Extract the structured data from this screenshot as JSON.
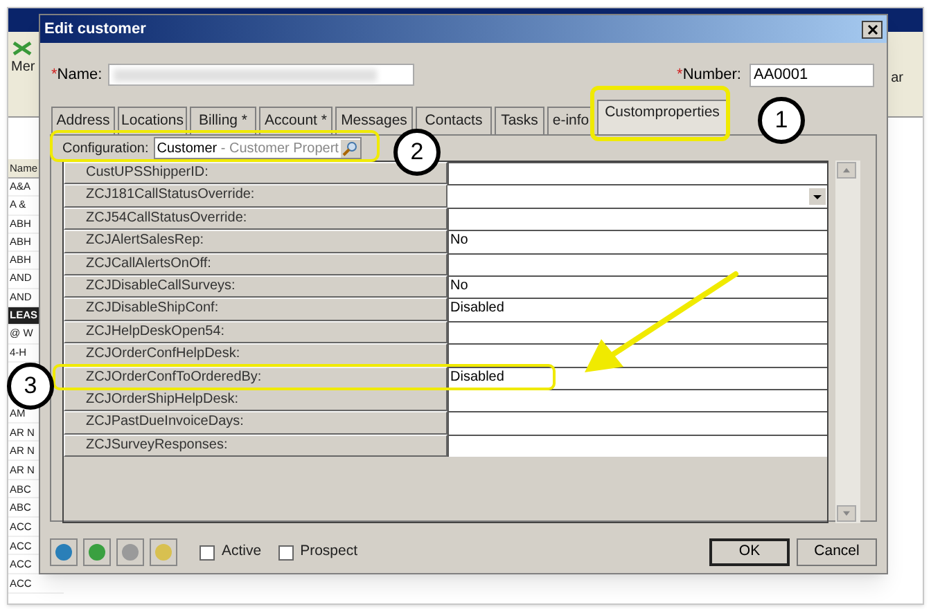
{
  "background_app": {
    "toolbar_label": "Mer",
    "toolbar_fragment": "ar",
    "list_header": "Name",
    "list_rows_upper": [
      {
        "text": "A&A",
        "selected": false
      },
      {
        "text": "A &",
        "selected": false
      },
      {
        "text": "ABH",
        "selected": false
      },
      {
        "text": "ABH",
        "selected": false
      },
      {
        "text": "ABH",
        "selected": false
      },
      {
        "text": "AND",
        "selected": false
      },
      {
        "text": "AND",
        "selected": false
      },
      {
        "text": "LEAS",
        "selected": true
      },
      {
        "text": "@ W",
        "selected": false
      },
      {
        "text": "4-H",
        "selected": false
      }
    ],
    "list_rows_lower": [
      {
        "text": "AM",
        "selected": false
      },
      {
        "text": "AR N",
        "selected": false
      },
      {
        "text": "AR N",
        "selected": false
      },
      {
        "text": "AR N",
        "selected": false
      },
      {
        "text": "ABC",
        "selected": false
      },
      {
        "text": "ABC",
        "selected": false
      },
      {
        "text": "ACC",
        "selected": false
      },
      {
        "text": "ACC",
        "selected": false
      },
      {
        "text": "ACC",
        "selected": false
      },
      {
        "text": "ACC",
        "selected": false
      }
    ]
  },
  "dialog": {
    "title": "Edit customer",
    "name": {
      "label": "Name:",
      "required_mark": "*"
    },
    "number": {
      "label": "Number:",
      "required_mark": "*",
      "value": "AA0001"
    },
    "tabs": [
      {
        "label": "Address",
        "selected": false
      },
      {
        "label": "Locations",
        "selected": false
      },
      {
        "label": "Billing *",
        "selected": false
      },
      {
        "label": "Account *",
        "selected": false
      },
      {
        "label": "Messages",
        "selected": false
      },
      {
        "label": "Contacts",
        "selected": false
      },
      {
        "label": "Tasks",
        "selected": false
      },
      {
        "label": "e-info",
        "selected": false
      },
      {
        "label": "Customproperties",
        "selected": true
      }
    ],
    "configuration": {
      "label": "Configuration:",
      "value": "Customer",
      "detail": "- Customer Propert"
    },
    "properties": [
      {
        "label": "CustUPSShipperID:",
        "kind": "text"
      },
      {
        "label": "ZCJ181CallStatusOverride:",
        "kind": "dropdown"
      },
      {
        "label": "ZCJ54CallStatusOverride:",
        "kind": "text"
      },
      {
        "label": "ZCJAlertSalesRep:",
        "kind": "text",
        "value": "No"
      },
      {
        "label": "ZCJCallAlertsOnOff:",
        "kind": "text"
      },
      {
        "label": "ZCJDisableCallSurveys:",
        "kind": "text",
        "value": "No"
      },
      {
        "label": "ZCJDisableShipConf:",
        "kind": "text",
        "value": "Disabled"
      },
      {
        "label": "ZCJHelpDeskOpen54:",
        "kind": "text"
      },
      {
        "label": "ZCJOrderConfHelpDesk:",
        "kind": "text"
      },
      {
        "label": "ZCJOrderConfToOrderedBy:",
        "kind": "text",
        "value": "Disabled"
      },
      {
        "label": "ZCJOrderShipHelpDesk:",
        "kind": "text"
      },
      {
        "label": "ZCJPastDueInvoiceDays:",
        "kind": "text"
      },
      {
        "label": "ZCJSurveyResponses:",
        "kind": "text"
      }
    ],
    "checkboxes": [
      {
        "label": "Active",
        "checked": false
      },
      {
        "label": "Prospect",
        "checked": false
      }
    ],
    "buttons": [
      "OK",
      "Cancel"
    ]
  },
  "callouts": [
    "1",
    "2",
    "3"
  ]
}
